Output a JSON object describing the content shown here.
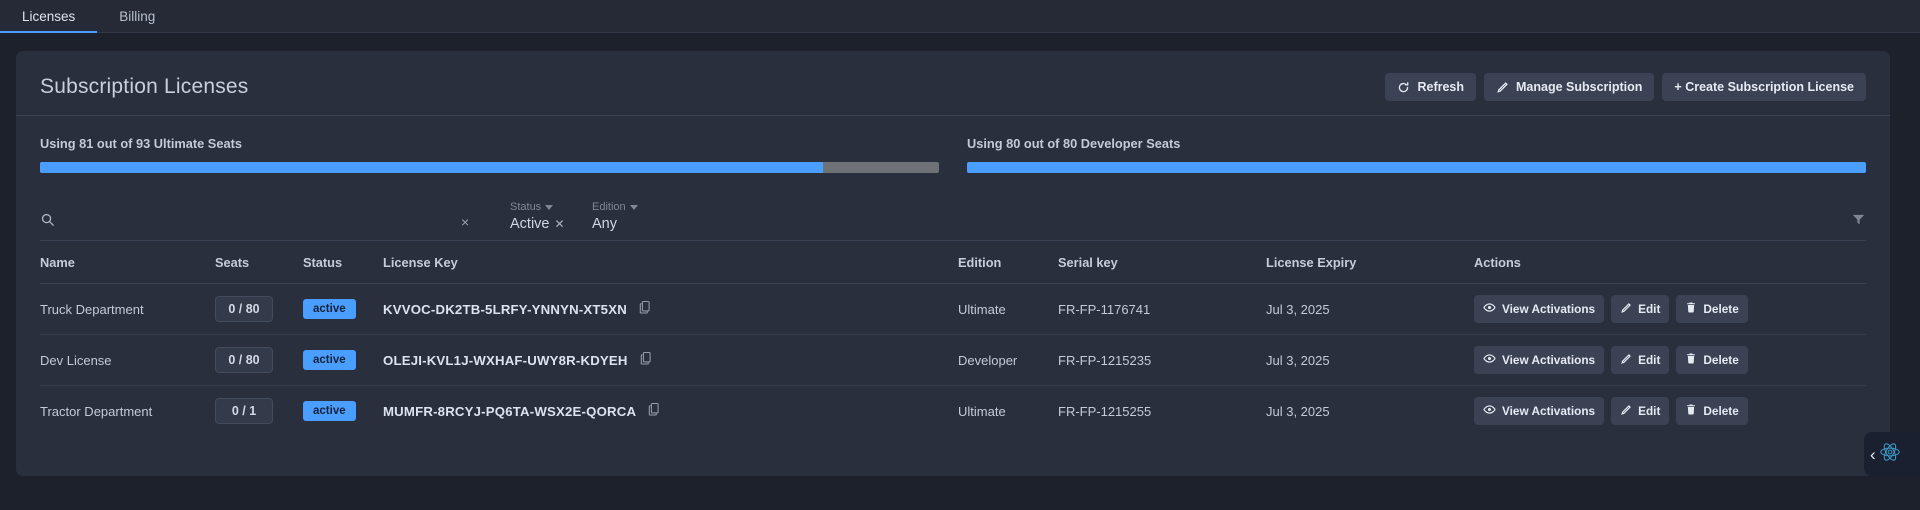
{
  "tabs": [
    {
      "label": "Licenses",
      "active": true
    },
    {
      "label": "Billing",
      "active": false
    }
  ],
  "card": {
    "title": "Subscription Licenses",
    "buttons": {
      "refresh": "Refresh",
      "manage": "Manage Subscription",
      "create": "+ Create Subscription License"
    }
  },
  "seats": [
    {
      "label": "Using 81 out of 93 Ultimate Seats",
      "used": 81,
      "total": 93,
      "percent": "87.1%"
    },
    {
      "label": "Using 80 out of 80 Developer Seats",
      "used": 80,
      "total": 80,
      "percent": "100%"
    }
  ],
  "filters": {
    "search_value": "",
    "search_placeholder": "",
    "clear_label": "×",
    "facets": [
      {
        "name": "Status",
        "value": "Active",
        "clearable": true
      },
      {
        "name": "Edition",
        "value": "Any",
        "clearable": false
      }
    ]
  },
  "table": {
    "columns": [
      "Name",
      "Seats",
      "Status",
      "License Key",
      "Edition",
      "Serial key",
      "License Expiry",
      "Actions"
    ],
    "row_actions": {
      "view": "View Activations",
      "edit": "Edit",
      "delete": "Delete"
    },
    "rows": [
      {
        "name": "Truck Department",
        "seats": "0 / 80",
        "status": "active",
        "license_key": "KVVOC-DK2TB-5LRFY-YNNYN-XT5XN",
        "edition": "Ultimate",
        "serial_key": "FR-FP-1176741",
        "expiry": "Jul 3, 2025"
      },
      {
        "name": "Dev License",
        "seats": "0 / 80",
        "status": "active",
        "license_key": "OLEJI-KVL1J-WXHAF-UWY8R-KDYEH",
        "edition": "Developer",
        "serial_key": "FR-FP-1215235",
        "expiry": "Jul 3, 2025"
      },
      {
        "name": "Tractor Department",
        "seats": "0 / 1",
        "status": "active",
        "license_key": "MUMFR-8RCYJ-PQ6TA-WSX2E-QORCA",
        "edition": "Ultimate",
        "serial_key": "FR-FP-1215255",
        "expiry": "Jul 3, 2025"
      }
    ]
  },
  "devtools": {
    "chevron": "‹"
  },
  "colors": {
    "accent": "#4a9eff",
    "page_bg": "#1d212b",
    "card_bg": "#2a2f3d",
    "button_bg": "#3b4254",
    "track_bg": "#6e7277"
  }
}
